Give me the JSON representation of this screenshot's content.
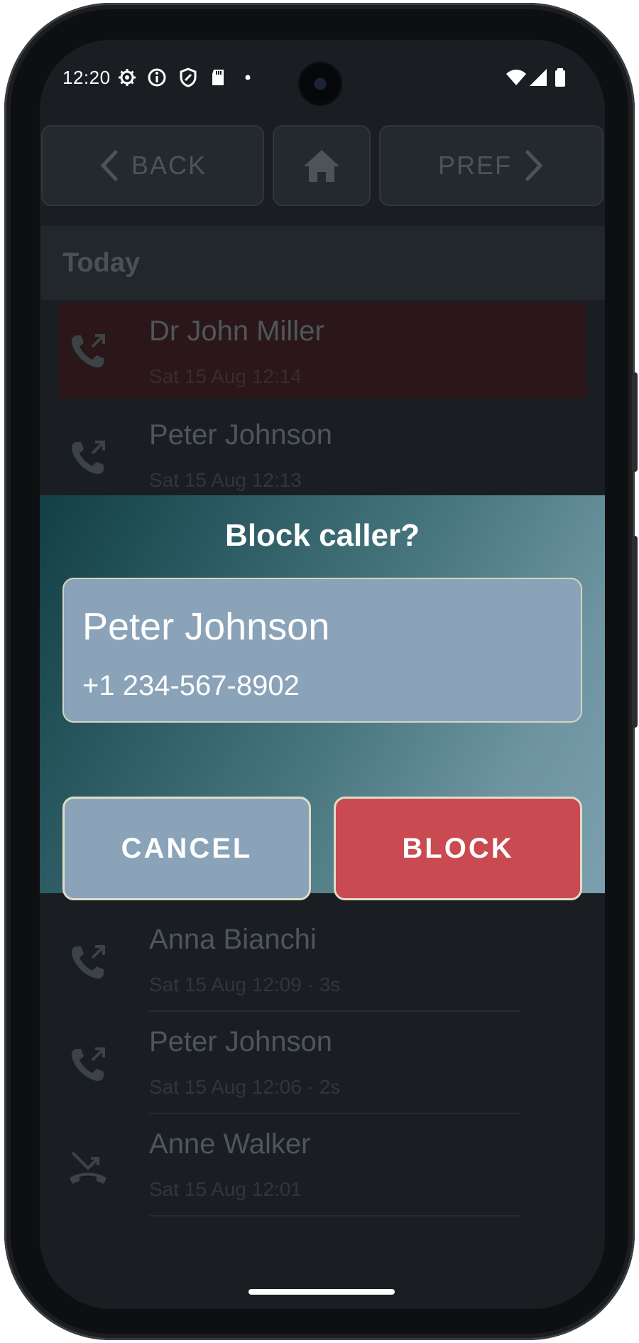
{
  "status_bar": {
    "time": "12:20",
    "icons": [
      "gear-icon",
      "info-icon",
      "shield-icon",
      "sd-card-icon",
      "dot-icon",
      "wifi-icon",
      "signal-icon",
      "battery-icon"
    ]
  },
  "nav": {
    "back_label": "BACK",
    "pref_label": "PREF",
    "home_icon": "home-icon"
  },
  "section": {
    "title": "Today"
  },
  "calls": [
    {
      "name": "Dr John Miller",
      "date": "Sat 15 Aug 12:14",
      "type": "outgoing",
      "highlighted": true
    },
    {
      "name": "Peter Johnson",
      "date": "Sat 15 Aug 12:13",
      "type": "outgoing",
      "highlighted": false
    },
    {
      "name": "Anna Bianchi",
      "date": "Sat 15 Aug 12:09 · 3s",
      "type": "outgoing",
      "highlighted": false
    },
    {
      "name": "Peter Johnson",
      "date": "Sat 15 Aug 12:06 · 2s",
      "type": "outgoing",
      "highlighted": false
    },
    {
      "name": "Anne Walker",
      "date": "Sat 15 Aug 12:01",
      "type": "missed",
      "highlighted": false
    }
  ],
  "dialog": {
    "title": "Block caller?",
    "contact_name": "Peter Johnson",
    "contact_number": "+1 234-567-8902",
    "cancel_label": "CANCEL",
    "block_label": "BLOCK"
  },
  "colors": {
    "block_button": "#c94a50",
    "cancel_button": "#8aa3b9",
    "highlight_row": "#2b1719"
  }
}
